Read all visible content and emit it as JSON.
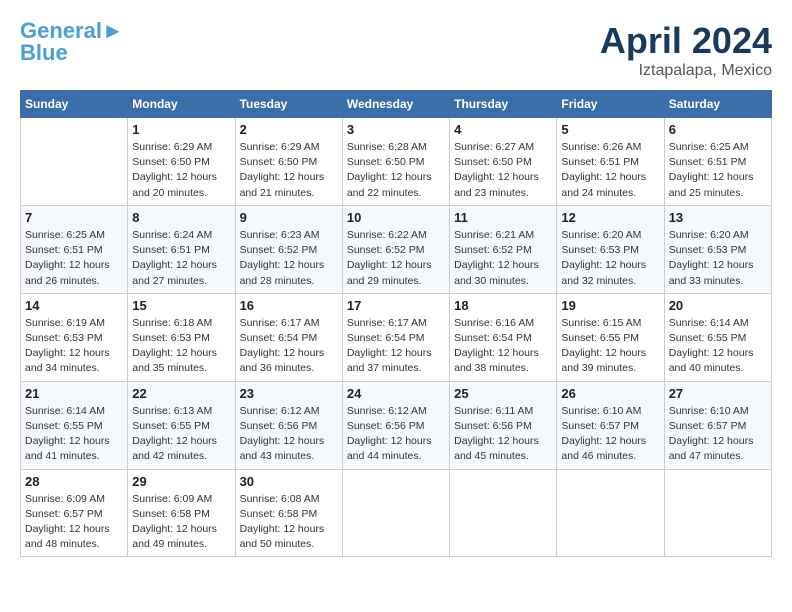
{
  "header": {
    "logo_line1": "General",
    "logo_line2": "Blue",
    "month": "April 2024",
    "location": "Iztapalapa, Mexico"
  },
  "days_of_week": [
    "Sunday",
    "Monday",
    "Tuesday",
    "Wednesday",
    "Thursday",
    "Friday",
    "Saturday"
  ],
  "weeks": [
    [
      {
        "day": "",
        "info": ""
      },
      {
        "day": "1",
        "info": "Sunrise: 6:29 AM\nSunset: 6:50 PM\nDaylight: 12 hours\nand 20 minutes."
      },
      {
        "day": "2",
        "info": "Sunrise: 6:29 AM\nSunset: 6:50 PM\nDaylight: 12 hours\nand 21 minutes."
      },
      {
        "day": "3",
        "info": "Sunrise: 6:28 AM\nSunset: 6:50 PM\nDaylight: 12 hours\nand 22 minutes."
      },
      {
        "day": "4",
        "info": "Sunrise: 6:27 AM\nSunset: 6:50 PM\nDaylight: 12 hours\nand 23 minutes."
      },
      {
        "day": "5",
        "info": "Sunrise: 6:26 AM\nSunset: 6:51 PM\nDaylight: 12 hours\nand 24 minutes."
      },
      {
        "day": "6",
        "info": "Sunrise: 6:25 AM\nSunset: 6:51 PM\nDaylight: 12 hours\nand 25 minutes."
      }
    ],
    [
      {
        "day": "7",
        "info": "Sunrise: 6:25 AM\nSunset: 6:51 PM\nDaylight: 12 hours\nand 26 minutes."
      },
      {
        "day": "8",
        "info": "Sunrise: 6:24 AM\nSunset: 6:51 PM\nDaylight: 12 hours\nand 27 minutes."
      },
      {
        "day": "9",
        "info": "Sunrise: 6:23 AM\nSunset: 6:52 PM\nDaylight: 12 hours\nand 28 minutes."
      },
      {
        "day": "10",
        "info": "Sunrise: 6:22 AM\nSunset: 6:52 PM\nDaylight: 12 hours\nand 29 minutes."
      },
      {
        "day": "11",
        "info": "Sunrise: 6:21 AM\nSunset: 6:52 PM\nDaylight: 12 hours\nand 30 minutes."
      },
      {
        "day": "12",
        "info": "Sunrise: 6:20 AM\nSunset: 6:53 PM\nDaylight: 12 hours\nand 32 minutes."
      },
      {
        "day": "13",
        "info": "Sunrise: 6:20 AM\nSunset: 6:53 PM\nDaylight: 12 hours\nand 33 minutes."
      }
    ],
    [
      {
        "day": "14",
        "info": "Sunrise: 6:19 AM\nSunset: 6:53 PM\nDaylight: 12 hours\nand 34 minutes."
      },
      {
        "day": "15",
        "info": "Sunrise: 6:18 AM\nSunset: 6:53 PM\nDaylight: 12 hours\nand 35 minutes."
      },
      {
        "day": "16",
        "info": "Sunrise: 6:17 AM\nSunset: 6:54 PM\nDaylight: 12 hours\nand 36 minutes."
      },
      {
        "day": "17",
        "info": "Sunrise: 6:17 AM\nSunset: 6:54 PM\nDaylight: 12 hours\nand 37 minutes."
      },
      {
        "day": "18",
        "info": "Sunrise: 6:16 AM\nSunset: 6:54 PM\nDaylight: 12 hours\nand 38 minutes."
      },
      {
        "day": "19",
        "info": "Sunrise: 6:15 AM\nSunset: 6:55 PM\nDaylight: 12 hours\nand 39 minutes."
      },
      {
        "day": "20",
        "info": "Sunrise: 6:14 AM\nSunset: 6:55 PM\nDaylight: 12 hours\nand 40 minutes."
      }
    ],
    [
      {
        "day": "21",
        "info": "Sunrise: 6:14 AM\nSunset: 6:55 PM\nDaylight: 12 hours\nand 41 minutes."
      },
      {
        "day": "22",
        "info": "Sunrise: 6:13 AM\nSunset: 6:55 PM\nDaylight: 12 hours\nand 42 minutes."
      },
      {
        "day": "23",
        "info": "Sunrise: 6:12 AM\nSunset: 6:56 PM\nDaylight: 12 hours\nand 43 minutes."
      },
      {
        "day": "24",
        "info": "Sunrise: 6:12 AM\nSunset: 6:56 PM\nDaylight: 12 hours\nand 44 minutes."
      },
      {
        "day": "25",
        "info": "Sunrise: 6:11 AM\nSunset: 6:56 PM\nDaylight: 12 hours\nand 45 minutes."
      },
      {
        "day": "26",
        "info": "Sunrise: 6:10 AM\nSunset: 6:57 PM\nDaylight: 12 hours\nand 46 minutes."
      },
      {
        "day": "27",
        "info": "Sunrise: 6:10 AM\nSunset: 6:57 PM\nDaylight: 12 hours\nand 47 minutes."
      }
    ],
    [
      {
        "day": "28",
        "info": "Sunrise: 6:09 AM\nSunset: 6:57 PM\nDaylight: 12 hours\nand 48 minutes."
      },
      {
        "day": "29",
        "info": "Sunrise: 6:09 AM\nSunset: 6:58 PM\nDaylight: 12 hours\nand 49 minutes."
      },
      {
        "day": "30",
        "info": "Sunrise: 6:08 AM\nSunset: 6:58 PM\nDaylight: 12 hours\nand 50 minutes."
      },
      {
        "day": "",
        "info": ""
      },
      {
        "day": "",
        "info": ""
      },
      {
        "day": "",
        "info": ""
      },
      {
        "day": "",
        "info": ""
      }
    ]
  ]
}
